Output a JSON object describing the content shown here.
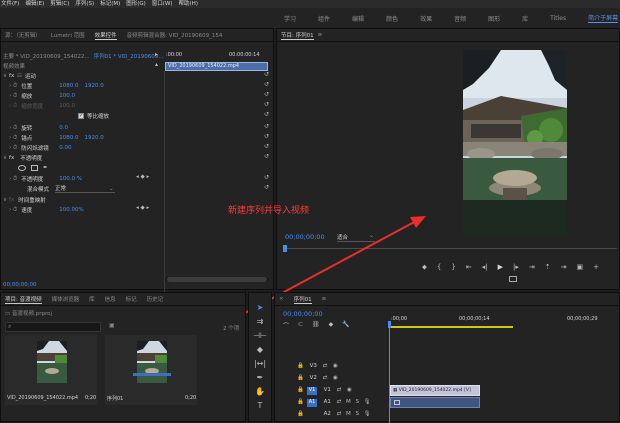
{
  "menu": [
    "文件(F)",
    "编辑(E)",
    "剪辑(C)",
    "序列(S)",
    "标记(M)",
    "图形(G)",
    "窗口(W)",
    "帮助(H)"
  ],
  "workspaces": {
    "items": [
      "学习",
      "组件",
      "编辑",
      "颜色",
      "效果",
      "音频",
      "图形",
      "库",
      "Titles"
    ],
    "active": "简介于屏幕"
  },
  "left_tabs": {
    "t1": "源：（无剪辑）",
    "t2": "Lumetri 范围",
    "t3": "效果控件",
    "t4": "音频剪辑混合器: VID_20190609_154"
  },
  "effect_controls": {
    "master": "主要 * VID_20190609_154022...",
    "sequence": "序列01 * VID_20190609...",
    "time_start": ":00:00",
    "time_end": "00:00:00:14",
    "clip_name": "VID_20190609_154022.mp4",
    "video_effects": "视频效果",
    "motion": "运动",
    "position_label": "位置",
    "position_x": "1080.0",
    "position_y": "1920.0",
    "scale_label": "缩放",
    "scale_value": "100.0",
    "scale_width_label": "缩放宽度",
    "scale_width_value": "100.0",
    "uniform_scale": "等比缩放",
    "rotation_label": "旋转",
    "rotation_value": "0.0",
    "anchor_label": "锚点",
    "anchor_x": "1080.0",
    "anchor_y": "1920.0",
    "flicker_label": "防闪烁滤镜",
    "flicker_value": "0.00",
    "opacity_group": "不透明度",
    "opacity_label": "不透明度",
    "opacity_value": "100.0 %",
    "blend_label": "混合模式",
    "blend_value": "正常",
    "time_remap": "时间重映射",
    "speed_label": "速度",
    "speed_value": "100.00%",
    "timecode": "00;00;00;00"
  },
  "program": {
    "tab": "节目: 序列01",
    "timecode": "00;00;00;00",
    "fit": "适合"
  },
  "annotation": "新建序列并导入视频",
  "project": {
    "tabs": [
      "项目: 音渡视频",
      "媒体浏览器",
      "库",
      "信息",
      "标记",
      "历史记"
    ],
    "project_file": "音渡视频.prproj",
    "count": "2 个项",
    "items": [
      {
        "name": "VID_20190609_154022.mp4",
        "duration": "0;20"
      },
      {
        "name": "序列01",
        "duration": "0;20"
      }
    ]
  },
  "timeline": {
    "tab": "序列01",
    "timecode": "00;00;00;00",
    "ruler": [
      ":00;00",
      "00;00;00;14",
      "00;00;00;29"
    ],
    "tracks": [
      "V3",
      "V2",
      "V1",
      "A1",
      "A2",
      "A3"
    ],
    "track_flags": [
      "M",
      "S"
    ],
    "clip_label": "VID_20190609_154022.mp4 [V]"
  },
  "colors": {
    "accent": "#4a8ff0",
    "arrow": "#e8302a",
    "timeline_bar": "#d6c900",
    "clip": "#5a6a8a"
  }
}
